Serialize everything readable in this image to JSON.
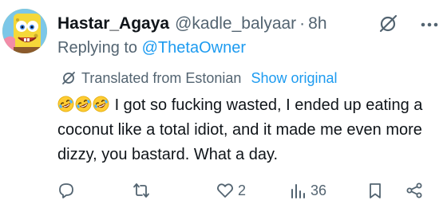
{
  "user": {
    "display_name": "Hastar_Agaya",
    "handle": "@kadle_balyaar",
    "separator": "·",
    "time": "8h"
  },
  "reply": {
    "prefix": "Replying to ",
    "mention": "@ThetaOwner"
  },
  "translation": {
    "label": "Translated from Estonian",
    "show_original": "Show original"
  },
  "tweet": {
    "text": "I got so fucking wasted, I ended up eating a coconut like a total idiot, and it made me even more dizzy, you bastard. What a day."
  },
  "actions": {
    "like_count": "2",
    "views_count": "36"
  },
  "colors": {
    "accent": "#1d9bf0",
    "secondary_text": "#536471",
    "primary_text": "#0f1419"
  }
}
